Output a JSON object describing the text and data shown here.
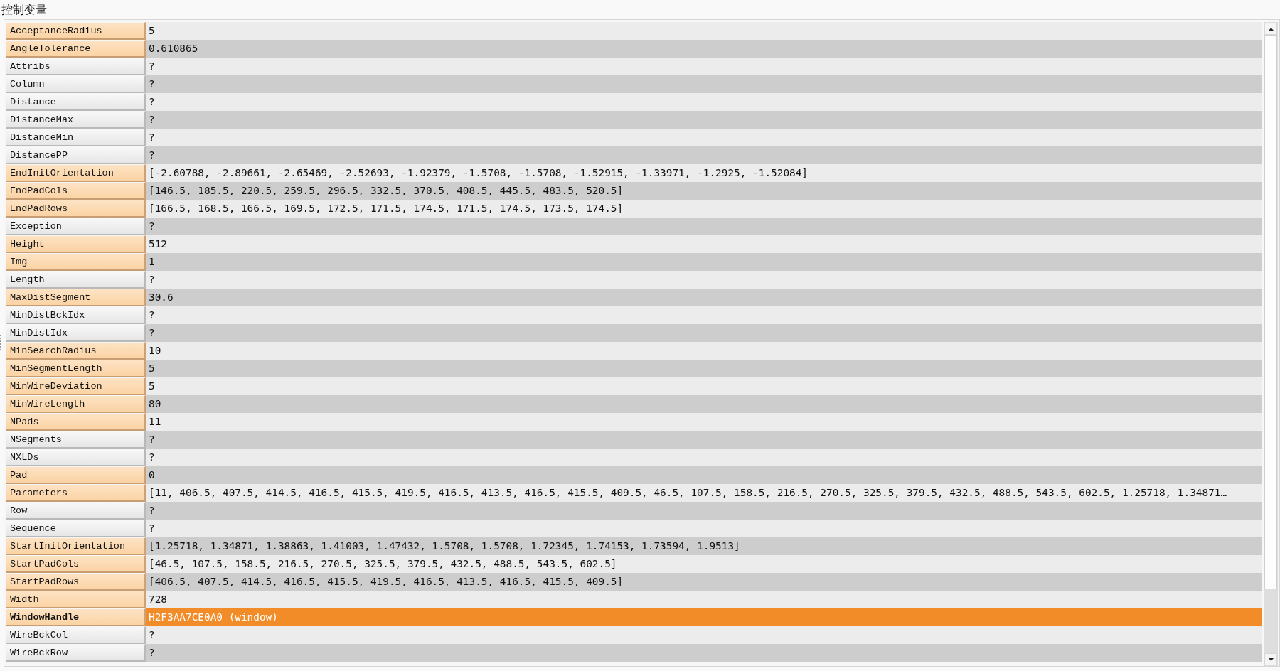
{
  "panel": {
    "title": "控制变量"
  },
  "variables": [
    {
      "name": "AcceptanceRadius",
      "value": "5",
      "defined": true,
      "selected": false
    },
    {
      "name": "AngleTolerance",
      "value": "0.610865",
      "defined": true,
      "selected": false
    },
    {
      "name": "Attribs",
      "value": "?",
      "defined": false,
      "selected": false
    },
    {
      "name": "Column",
      "value": "?",
      "defined": false,
      "selected": false
    },
    {
      "name": "Distance",
      "value": "?",
      "defined": false,
      "selected": false
    },
    {
      "name": "DistanceMax",
      "value": "?",
      "defined": false,
      "selected": false
    },
    {
      "name": "DistanceMin",
      "value": "?",
      "defined": false,
      "selected": false
    },
    {
      "name": "DistancePP",
      "value": "?",
      "defined": false,
      "selected": false
    },
    {
      "name": "EndInitOrientation",
      "value": "[-2.60788, -2.89661, -2.65469, -2.52693, -1.92379, -1.5708, -1.5708, -1.52915, -1.33971, -1.2925, -1.52084]",
      "defined": true,
      "selected": false
    },
    {
      "name": "EndPadCols",
      "value": "[146.5, 185.5, 220.5, 259.5, 296.5, 332.5, 370.5, 408.5, 445.5, 483.5, 520.5]",
      "defined": true,
      "selected": false
    },
    {
      "name": "EndPadRows",
      "value": "[166.5, 168.5, 166.5, 169.5, 172.5, 171.5, 174.5, 171.5, 174.5, 173.5, 174.5]",
      "defined": true,
      "selected": false
    },
    {
      "name": "Exception",
      "value": "?",
      "defined": false,
      "selected": false
    },
    {
      "name": "Height",
      "value": "512",
      "defined": true,
      "selected": false
    },
    {
      "name": "Img",
      "value": "1",
      "defined": true,
      "selected": false
    },
    {
      "name": "Length",
      "value": "?",
      "defined": false,
      "selected": false
    },
    {
      "name": "MaxDistSegment",
      "value": "30.6",
      "defined": true,
      "selected": false
    },
    {
      "name": "MinDistBckIdx",
      "value": "?",
      "defined": false,
      "selected": false
    },
    {
      "name": "MinDistIdx",
      "value": "?",
      "defined": false,
      "selected": false
    },
    {
      "name": "MinSearchRadius",
      "value": "10",
      "defined": true,
      "selected": false
    },
    {
      "name": "MinSegmentLength",
      "value": "5",
      "defined": true,
      "selected": false
    },
    {
      "name": "MinWireDeviation",
      "value": "5",
      "defined": true,
      "selected": false
    },
    {
      "name": "MinWireLength",
      "value": "80",
      "defined": true,
      "selected": false
    },
    {
      "name": "NPads",
      "value": "11",
      "defined": true,
      "selected": false
    },
    {
      "name": "NSegments",
      "value": "?",
      "defined": false,
      "selected": false
    },
    {
      "name": "NXLDs",
      "value": "?",
      "defined": false,
      "selected": false
    },
    {
      "name": "Pad",
      "value": "0",
      "defined": true,
      "selected": false
    },
    {
      "name": "Parameters",
      "value": "[11, 406.5, 407.5, 414.5, 416.5, 415.5, 419.5, 416.5, 413.5, 416.5, 415.5, 409.5, 46.5, 107.5, 158.5, 216.5, 270.5, 325.5, 379.5, 432.5, 488.5, 543.5, 602.5, 1.25718, 1.34871…",
      "defined": true,
      "selected": false
    },
    {
      "name": "Row",
      "value": "?",
      "defined": false,
      "selected": false
    },
    {
      "name": "Sequence",
      "value": "?",
      "defined": false,
      "selected": false
    },
    {
      "name": "StartInitOrientation",
      "value": "[1.25718, 1.34871, 1.38863, 1.41003, 1.47432, 1.5708, 1.5708, 1.72345, 1.74153, 1.73594, 1.9513]",
      "defined": true,
      "selected": false
    },
    {
      "name": "StartPadCols",
      "value": "[46.5, 107.5, 158.5, 216.5, 270.5, 325.5, 379.5, 432.5, 488.5, 543.5, 602.5]",
      "defined": true,
      "selected": false
    },
    {
      "name": "StartPadRows",
      "value": "[406.5, 407.5, 414.5, 416.5, 415.5, 419.5, 416.5, 413.5, 416.5, 415.5, 409.5]",
      "defined": true,
      "selected": false
    },
    {
      "name": "Width",
      "value": "728",
      "defined": true,
      "selected": false
    },
    {
      "name": "WindowHandle",
      "value": "H2F3AA7CE0A0 (window)",
      "defined": true,
      "selected": true
    },
    {
      "name": "WireBckCol",
      "value": "?",
      "defined": false,
      "selected": false
    },
    {
      "name": "WireBckRow",
      "value": "?",
      "defined": false,
      "selected": false
    }
  ]
}
